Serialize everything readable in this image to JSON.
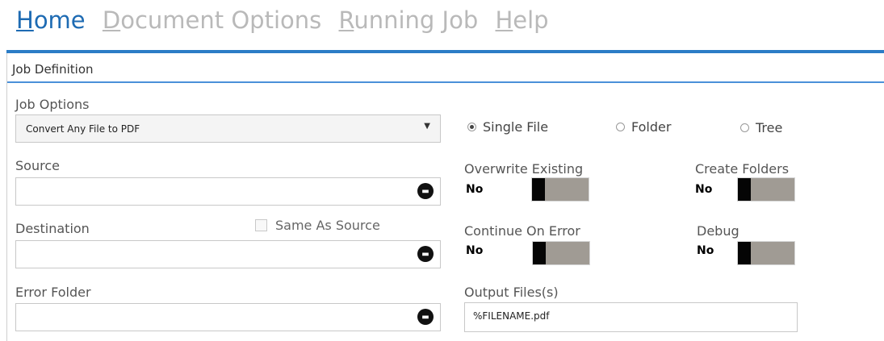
{
  "menu": {
    "home": {
      "first": "H",
      "rest": "ome"
    },
    "document_options": {
      "first": "D",
      "rest": "ocument Options"
    },
    "running_job": {
      "first": "R",
      "rest": "unning Job"
    },
    "help": {
      "first": "H",
      "rest": "elp"
    }
  },
  "panel": {
    "title": "Job Definition"
  },
  "job_options": {
    "label": "Job Options",
    "value": "Convert Any File to PDF"
  },
  "source": {
    "label": "Source",
    "value": ""
  },
  "destination": {
    "label": "Destination",
    "value": "",
    "same_as_source": "Same As Source"
  },
  "error_folder": {
    "label": "Error Folder",
    "value": ""
  },
  "mode": {
    "single_file": "Single File",
    "folder": "Folder",
    "tree": "Tree",
    "selected": "single_file"
  },
  "overwrite_existing": {
    "label": "Overwrite Existing",
    "value": "No"
  },
  "create_folders": {
    "label": "Create Folders",
    "value": "No"
  },
  "continue_on_error": {
    "label": "Continue On Error",
    "value": "No"
  },
  "debug": {
    "label": "Debug",
    "value": "No"
  },
  "output_files": {
    "label": "Output Files(s)",
    "value": "%FILENAME.pdf"
  },
  "icons": {
    "browse": "folder-open-icon",
    "dropdown": "chevron-down-icon"
  },
  "colors": {
    "accent": "#1e6bb3",
    "menu_inactive": "#b9b9b9",
    "toggle_track": "#a09b94"
  }
}
